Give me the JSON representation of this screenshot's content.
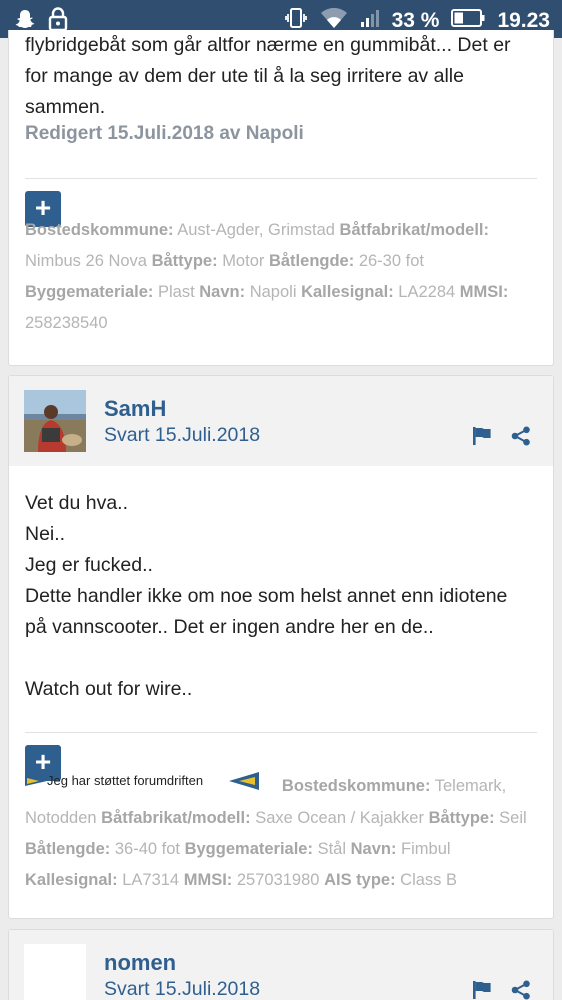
{
  "status_bar": {
    "battery": "33 %",
    "time": "19.23"
  },
  "post1": {
    "text_lines": [
      "flybridgebåt som går altfor nærme en gummibåt... Det er",
      "for mange av dem der ute til å la seg irritere av alle",
      "sammen."
    ],
    "edit_note": "Redigert 15.Juli.2018 av Napoli",
    "plus": "+",
    "signature": [
      {
        "label": "Bostedskommune:",
        "value": "Aust-Agder, Grimstad"
      },
      {
        "label": "Båtfabrikat/modell:",
        "value": "Nimbus 26 Nova"
      },
      {
        "label": "Båttype:",
        "value": "Motor"
      },
      {
        "label": "Båtlengde:",
        "value": "26-30 fot"
      },
      {
        "label": "Byggemateriale:",
        "value": "Plast"
      },
      {
        "label": "Navn:",
        "value": "Napoli"
      },
      {
        "label": "Kallesignal:",
        "value": "LA2284"
      },
      {
        "label": "MMSI:",
        "value": "258238540"
      }
    ]
  },
  "post2": {
    "author": "SamH",
    "date": "Svart 15.Juli.2018",
    "body": [
      "Vet du hva..",
      "Nei..",
      "Jeg er fucked..",
      "Dette handler ikke om noe som helst annet enn idiotene",
      "på vannscooter.. Det er ingen andre her en de..",
      "",
      "Watch out for wire.."
    ],
    "plus": "+",
    "support_badge": "Jeg har støttet forumdriften",
    "signature": [
      {
        "label": "Bostedskommune:",
        "value": "Telemark, Notodden"
      },
      {
        "label": "Båtfabrikat/modell:",
        "value": "Saxe Ocean / Kajakker"
      },
      {
        "label": "Båttype:",
        "value": "Seil"
      },
      {
        "label": "Båtlengde:",
        "value": "36-40 fot"
      },
      {
        "label": "Byggemateriale:",
        "value": "Stål"
      },
      {
        "label": "Navn:",
        "value": "Fimbul"
      },
      {
        "label": "Kallesignal:",
        "value": "LA7314"
      },
      {
        "label": "MMSI:",
        "value": "257031980"
      },
      {
        "label": "AIS type:",
        "value": "Class B"
      }
    ]
  },
  "post3": {
    "author": "nomen",
    "date": "Svart 15.Juli.2018"
  },
  "colors": {
    "status_bar": "#2f4e70",
    "accent": "#2f5f8f",
    "muted": "#b5b5b5"
  },
  "icons": [
    "snapchat-icon",
    "lock-icon",
    "vibrate-icon",
    "wifi-icon",
    "signal-icon",
    "battery-icon",
    "flag-icon",
    "share-icon"
  ]
}
